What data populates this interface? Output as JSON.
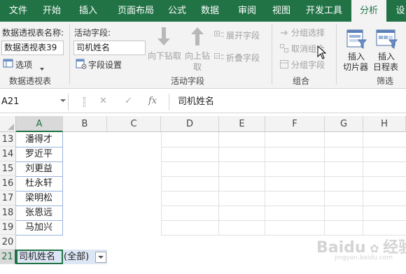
{
  "ribbon_tabs": [
    {
      "label": "文件",
      "active": false
    },
    {
      "label": "开始",
      "active": false
    },
    {
      "label": "插入",
      "active": false
    },
    {
      "label": "页面布局",
      "active": false
    },
    {
      "label": "公式",
      "active": false
    },
    {
      "label": "数据",
      "active": false
    },
    {
      "label": "审阅",
      "active": false
    },
    {
      "label": "视图",
      "active": false
    },
    {
      "label": "开发工具",
      "active": false
    },
    {
      "label": "分析",
      "active": true
    },
    {
      "label": "设",
      "active": false
    }
  ],
  "pivot_group": {
    "name_label": "数据透视表名称:",
    "name_value": "数据透视表39",
    "options_label": "选项",
    "group_name": "数据透视表"
  },
  "active_field_group": {
    "field_label": "活动字段:",
    "field_value": "司机姓名",
    "field_settings_label": "字段设置",
    "drill_down_label": "向下钻取",
    "drill_up_label_line1": "向上钻",
    "drill_up_label_line2": "取",
    "expand_field_label": "展开字段",
    "collapse_field_label": "折叠字段",
    "group_name": "活动字段"
  },
  "group_group": {
    "group_selection_label": "分组选择",
    "ungroup_label": "取消组合",
    "group_field_label": "分组字段",
    "group_name": "组合"
  },
  "filter_group": {
    "insert_slicer_line1": "插入",
    "insert_slicer_line2": "切片器",
    "insert_timeline_line1": "插入",
    "insert_timeline_line2": "日程表",
    "group_name": "筛选"
  },
  "formula_bar": {
    "name_box": "A21",
    "cancel_symbol": "✕",
    "enter_symbol": "✓",
    "fx_symbol": "fx",
    "content": "司机姓名"
  },
  "columns": [
    "A",
    "B",
    "C",
    "D",
    "E",
    "F",
    "G",
    "H"
  ],
  "selected_column": "A",
  "rows": [
    {
      "num": "13",
      "a": "潘得才"
    },
    {
      "num": "14",
      "a": "罗近平"
    },
    {
      "num": "15",
      "a": "刘更益"
    },
    {
      "num": "16",
      "a": "杜永轩"
    },
    {
      "num": "17",
      "a": "梁明松"
    },
    {
      "num": "18",
      "a": "张恩远"
    },
    {
      "num": "19",
      "a": "马加兴"
    },
    {
      "num": "20",
      "a": ""
    },
    {
      "num": "21",
      "a": "司机姓名",
      "b": "(全部)"
    }
  ],
  "selected_row": "21",
  "watermark": {
    "brand": "Baidu",
    "suffix": "经验",
    "sub": "jingyan.baidu.com"
  },
  "colors": {
    "accent": "#217346",
    "ribbon_bg": "#f3f3f3",
    "selected_header_bg": "#d9d9d9",
    "pivot_cell_bg": "#dde6f5"
  }
}
